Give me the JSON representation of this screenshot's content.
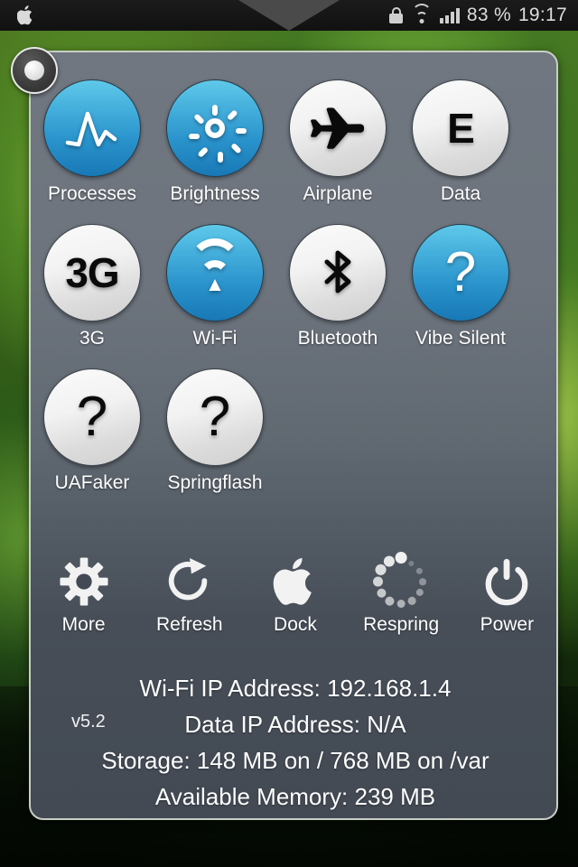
{
  "statusbar": {
    "apple_icon": "apple-icon",
    "lock_icon": "lock-icon",
    "wifi_icon": "wifi-icon",
    "signal_icon": "signal-bars-icon",
    "battery": "83 %",
    "time": "19:17"
  },
  "panel": {
    "handle_icon": "panel-handle-icon",
    "accent_on": "#2a93cc",
    "accent_off": "#ededed",
    "background": "#606874"
  },
  "toggles": [
    {
      "label": "Processes",
      "icon": "waveform-icon",
      "state": "on"
    },
    {
      "label": "Brightness",
      "icon": "sun-icon",
      "state": "on"
    },
    {
      "label": "Airplane",
      "icon": "airplane-icon",
      "state": "off"
    },
    {
      "label": "Data",
      "icon": "edge-e-icon",
      "state": "off",
      "text": "E"
    },
    {
      "label": "3G",
      "icon": "three-g-icon",
      "state": "off",
      "text": "3G"
    },
    {
      "label": "Wi-Fi",
      "icon": "wifi-icon",
      "state": "on"
    },
    {
      "label": "Bluetooth",
      "icon": "bluetooth-icon",
      "state": "off"
    },
    {
      "label": "Vibe Silent",
      "icon": "question-icon",
      "state": "on",
      "text": "?"
    },
    {
      "label": "UAFaker",
      "icon": "question-icon",
      "state": "off",
      "text": "?"
    },
    {
      "label": "Springflash",
      "icon": "question-icon",
      "state": "off",
      "text": "?"
    }
  ],
  "actions": [
    {
      "label": "More",
      "icon": "gear-icon"
    },
    {
      "label": "Refresh",
      "icon": "refresh-icon"
    },
    {
      "label": "Dock",
      "icon": "apple-icon"
    },
    {
      "label": "Respring",
      "icon": "spinner-icon"
    },
    {
      "label": "Power",
      "icon": "power-icon"
    }
  ],
  "info": {
    "version": "v5.2",
    "lines": [
      "Wi-Fi IP Address: 192.168.1.4",
      "Data IP Address: N/A",
      "Storage: 148 MB on / 768 MB on /var",
      "Available Memory: 239 MB"
    ]
  }
}
